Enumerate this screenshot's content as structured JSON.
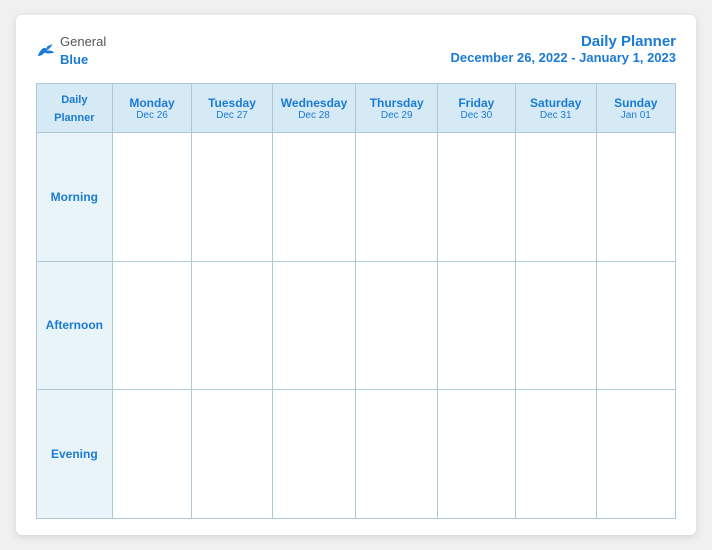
{
  "header": {
    "logo_general": "General",
    "logo_blue": "Blue",
    "title": "Daily Planner",
    "date_range": "December 26, 2022 - January 1, 2023"
  },
  "table": {
    "label_col": "Daily\nPlanner",
    "days": [
      {
        "name": "Monday",
        "date": "Dec 26"
      },
      {
        "name": "Tuesday",
        "date": "Dec 27"
      },
      {
        "name": "Wednesday",
        "date": "Dec 28"
      },
      {
        "name": "Thursday",
        "date": "Dec 29"
      },
      {
        "name": "Friday",
        "date": "Dec 30"
      },
      {
        "name": "Saturday",
        "date": "Dec 31"
      },
      {
        "name": "Sunday",
        "date": "Jan 01"
      }
    ],
    "rows": [
      {
        "label": "Morning"
      },
      {
        "label": "Afternoon"
      },
      {
        "label": "Evening"
      }
    ]
  }
}
